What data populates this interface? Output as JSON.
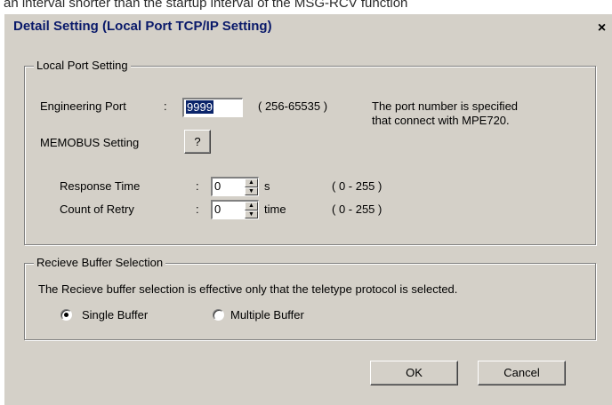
{
  "context_text": "an interval shorter than the startup interval of the MSG-RCV function",
  "dialog": {
    "title": "Detail Setting (Local Port TCP/IP Setting)",
    "close_label": "×"
  },
  "local_port": {
    "legend": "Local Port Setting",
    "engineering_port_label": "Engineering Port",
    "colon": ":",
    "engineering_port_value": "9999",
    "engineering_port_range": "( 256-65535 )",
    "description_line1": "The port number is specified",
    "description_line2": "that connect with MPE720.",
    "memobus_label": "MEMOBUS Setting",
    "memobus_button": "?",
    "response_time_label": "Response Time",
    "response_time_value": "0",
    "response_time_unit": "s",
    "response_time_range": "( 0 - 255 )",
    "retry_label": "Count of Retry",
    "retry_value": "0",
    "retry_unit": "time",
    "retry_range": "( 0 - 255 )"
  },
  "buffer": {
    "legend": "Recieve Buffer Selection",
    "note": "The Recieve buffer selection is effective only that the teletype protocol is selected.",
    "single_label": "Single Buffer",
    "multiple_label": "Multiple Buffer",
    "selected": "single"
  },
  "buttons": {
    "ok": "OK",
    "cancel": "Cancel"
  }
}
